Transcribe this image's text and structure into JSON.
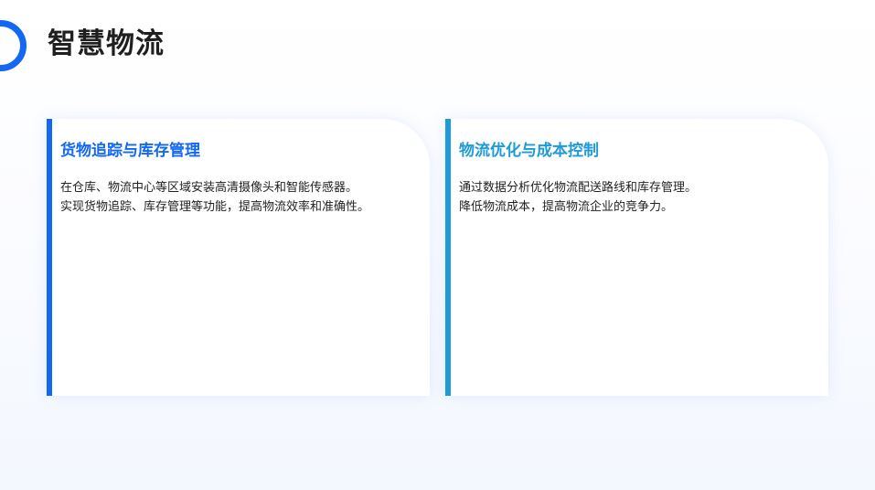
{
  "header": {
    "title": "智慧物流"
  },
  "cards": [
    {
      "title": "货物追踪与库存管理",
      "lines": [
        "在仓库、物流中心等区域安装高清摄像头和智能传感器。",
        "实现货物追踪、库存管理等功能，提高物流效率和准确性。"
      ]
    },
    {
      "title": "物流优化与成本控制",
      "lines": [
        "通过数据分析优化物流配送路线和库存管理。",
        "降低物流成本，提高物流企业的竞争力。"
      ]
    }
  ],
  "colors": {
    "accent_primary": "#1268f3",
    "accent_secondary": "#1e9ad8",
    "title_text": "#1f1f1f",
    "body_text": "#222222"
  }
}
